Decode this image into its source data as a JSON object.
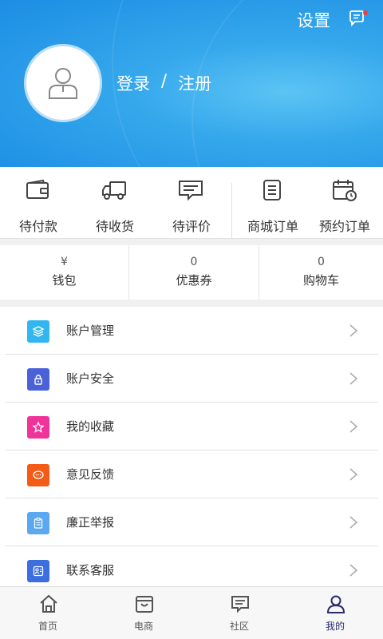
{
  "header": {
    "settings_label": "设置",
    "login_label": "登录",
    "separator": "/",
    "register_label": "注册",
    "notification_dot_color": "#ff3b30"
  },
  "orders": [
    {
      "label": "待付款",
      "icon": "wallet-icon"
    },
    {
      "label": "待收货",
      "icon": "truck-icon"
    },
    {
      "label": "待评价",
      "icon": "comment-icon"
    },
    {
      "label": "商城订单",
      "icon": "list-icon"
    },
    {
      "label": "预约订单",
      "icon": "calendar-icon"
    }
  ],
  "wallet": [
    {
      "value": "¥",
      "label": "钱包"
    },
    {
      "value": "0",
      "label": "优惠券"
    },
    {
      "value": "0",
      "label": "购物车"
    }
  ],
  "menu": [
    {
      "label": "账户管理",
      "icon": "layers-icon",
      "color": "#31b6ef"
    },
    {
      "label": "账户安全",
      "icon": "lock-icon",
      "color": "#4a62d8"
    },
    {
      "label": "我的收藏",
      "icon": "star-icon",
      "color": "#f0339a"
    },
    {
      "label": "意见反馈",
      "icon": "chat-icon",
      "color": "#f45b17"
    },
    {
      "label": "廉正举报",
      "icon": "clipboard-icon",
      "color": "#5aa8ef"
    },
    {
      "label": "联系客服",
      "icon": "contact-icon",
      "color": "#3d6ee0"
    }
  ],
  "bottom_nav": [
    {
      "label": "首页",
      "icon": "home-icon",
      "active": false
    },
    {
      "label": "电商",
      "icon": "shop-icon",
      "active": false
    },
    {
      "label": "社区",
      "icon": "community-icon",
      "active": false
    },
    {
      "label": "我的",
      "icon": "user-icon",
      "active": true
    }
  ],
  "colors": {
    "header_blue": "#2196e8",
    "active_nav": "#2c2a6e"
  }
}
